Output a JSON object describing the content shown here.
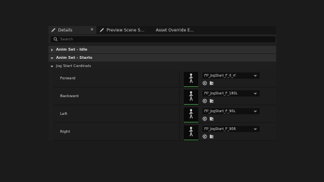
{
  "tabs": [
    {
      "label": "Details",
      "icon": "pencil-icon",
      "closable": true,
      "active": true
    },
    {
      "label": "Preview Scene S...",
      "icon": "pencil-icon",
      "active": false
    },
    {
      "label": "Asset Override E...",
      "active": false
    }
  ],
  "search": {
    "placeholder": "Search"
  },
  "categories": [
    {
      "label": "Anim Set - Idle",
      "expanded": false
    },
    {
      "label": "Anim Set - Starts",
      "expanded": true
    }
  ],
  "subcategory": {
    "label": "Jog Start Cardinals",
    "expanded": true
  },
  "rows": [
    {
      "label": "Forward",
      "asset": "FP_JogStart_F_0_rf"
    },
    {
      "label": "Backward",
      "asset": "FP_JogStart_F_180L"
    },
    {
      "label": "Left",
      "asset": "FP_JogStart_F_90L"
    },
    {
      "label": "Right",
      "asset": "FP_JogStart_F_90R"
    }
  ],
  "colors": {
    "background": "#1b1b1b",
    "category_bg": "#2e2e2e",
    "accent_green": "#3a8a3a"
  }
}
